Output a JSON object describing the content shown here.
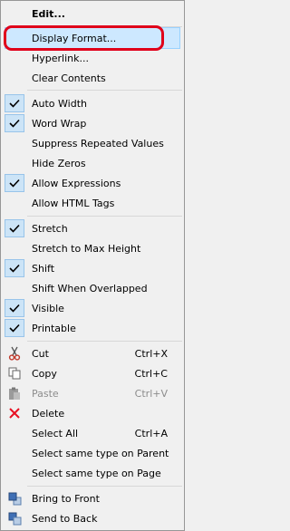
{
  "menu": {
    "items": [
      {
        "label": "Edit...",
        "bold": true
      },
      {
        "label": "Display Format...",
        "highlighted": true
      },
      {
        "label": "Hyperlink..."
      },
      {
        "label": "Clear Contents"
      },
      {
        "label": "Auto Width",
        "checked": true
      },
      {
        "label": "Word Wrap",
        "checked": true
      },
      {
        "label": "Suppress Repeated Values",
        "checked": false
      },
      {
        "label": "Hide Zeros",
        "checked": false
      },
      {
        "label": "Allow Expressions",
        "checked": true
      },
      {
        "label": "Allow HTML Tags",
        "checked": false
      },
      {
        "label": "Stretch",
        "checked": true
      },
      {
        "label": "Stretch to Max Height",
        "checked": false
      },
      {
        "label": "Shift",
        "checked": true
      },
      {
        "label": "Shift When Overlapped",
        "checked": false
      },
      {
        "label": "Visible",
        "checked": true
      },
      {
        "label": "Printable",
        "checked": true
      },
      {
        "label": "Cut",
        "shortcut": "Ctrl+X",
        "icon": "scissors-icon"
      },
      {
        "label": "Copy",
        "shortcut": "Ctrl+C",
        "icon": "copy-icon"
      },
      {
        "label": "Paste",
        "shortcut": "Ctrl+V",
        "icon": "paste-icon",
        "disabled": true
      },
      {
        "label": "Delete",
        "icon": "delete-x-icon"
      },
      {
        "label": "Select All",
        "shortcut": "Ctrl+A"
      },
      {
        "label": "Select same type on Parent"
      },
      {
        "label": "Select same type on Page"
      },
      {
        "label": "Bring to Front",
        "icon": "bring-to-front-icon"
      },
      {
        "label": "Send to Back",
        "icon": "send-to-back-icon"
      }
    ]
  },
  "colors": {
    "check_bg": "#cce4f7",
    "highlight_bg": "#cde8ff",
    "annotation_ring": "#e0001a",
    "delete_icon": "#e81123"
  }
}
